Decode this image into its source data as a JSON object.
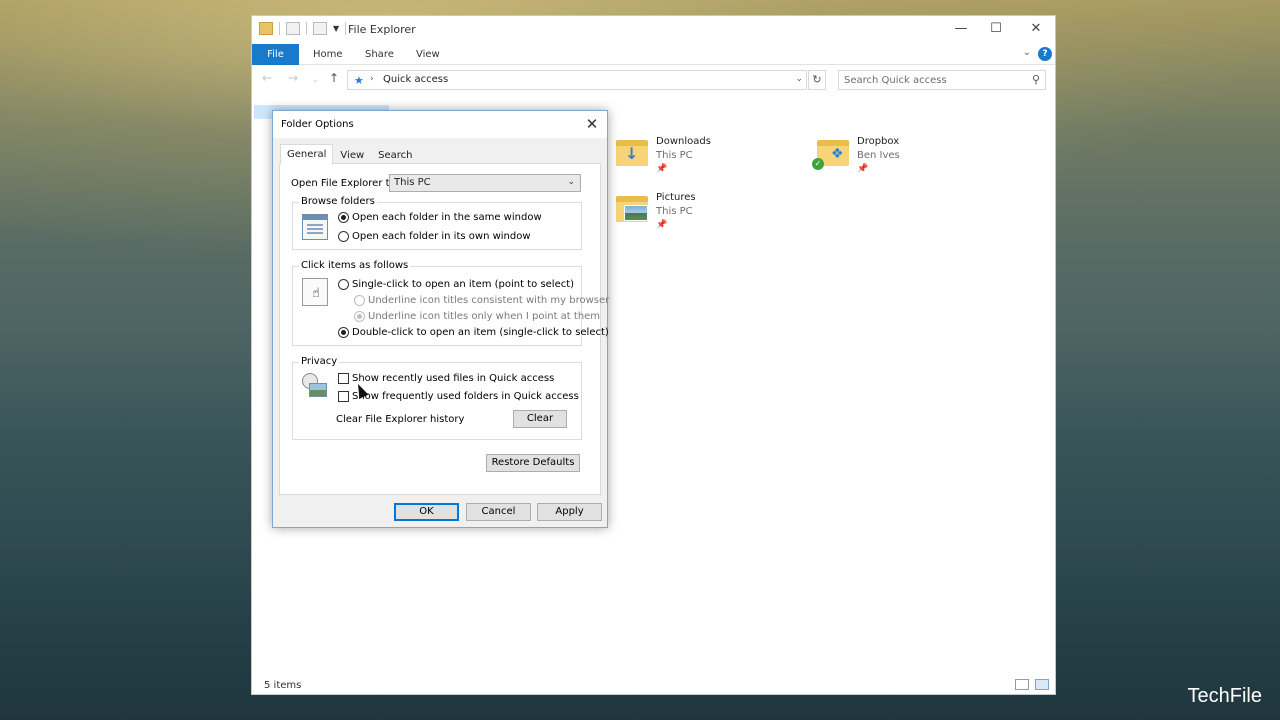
{
  "explorer": {
    "window_title": "File Explorer",
    "ribbon_tabs": {
      "file": "File",
      "home": "Home",
      "share": "Share",
      "view": "View"
    },
    "help": "?",
    "address": {
      "location": "Quick access"
    },
    "search": {
      "placeholder": "Search Quick access"
    },
    "tiles": [
      {
        "name": "Downloads",
        "location": "This PC",
        "icon": "downloads-folder-icon"
      },
      {
        "name": "Dropbox",
        "location": "Ben Ives",
        "icon": "dropbox-folder-icon"
      },
      {
        "name": "Pictures",
        "location": "This PC",
        "icon": "pictures-folder-icon"
      }
    ],
    "status": "5 items"
  },
  "dialog": {
    "title": "Folder Options",
    "tabs": {
      "general": "General",
      "view": "View",
      "search": "Search"
    },
    "open_to": {
      "label": "Open File Explorer to:",
      "value": "This PC"
    },
    "browse": {
      "title": "Browse folders",
      "same_window": "Open each folder in the same window",
      "own_window": "Open each folder in its own window"
    },
    "click": {
      "title": "Click items as follows",
      "single": "Single-click to open an item (point to select)",
      "underline_browser": "Underline icon titles consistent with my browser",
      "underline_point": "Underline icon titles only when I point at them",
      "double": "Double-click to open an item (single-click to select)"
    },
    "privacy": {
      "title": "Privacy",
      "recent_files": "Show recently used files in Quick access",
      "frequent_folders": "Show frequently used folders in Quick access",
      "clear_label": "Clear File Explorer history",
      "clear_button": "Clear"
    },
    "restore_defaults": "Restore Defaults",
    "ok": "OK",
    "cancel": "Cancel",
    "apply": "Apply"
  },
  "watermark": "TechFile",
  "colors": {
    "accent": "#1979ca",
    "focus_border": "#0078d7",
    "selection": "#cce8ff"
  }
}
